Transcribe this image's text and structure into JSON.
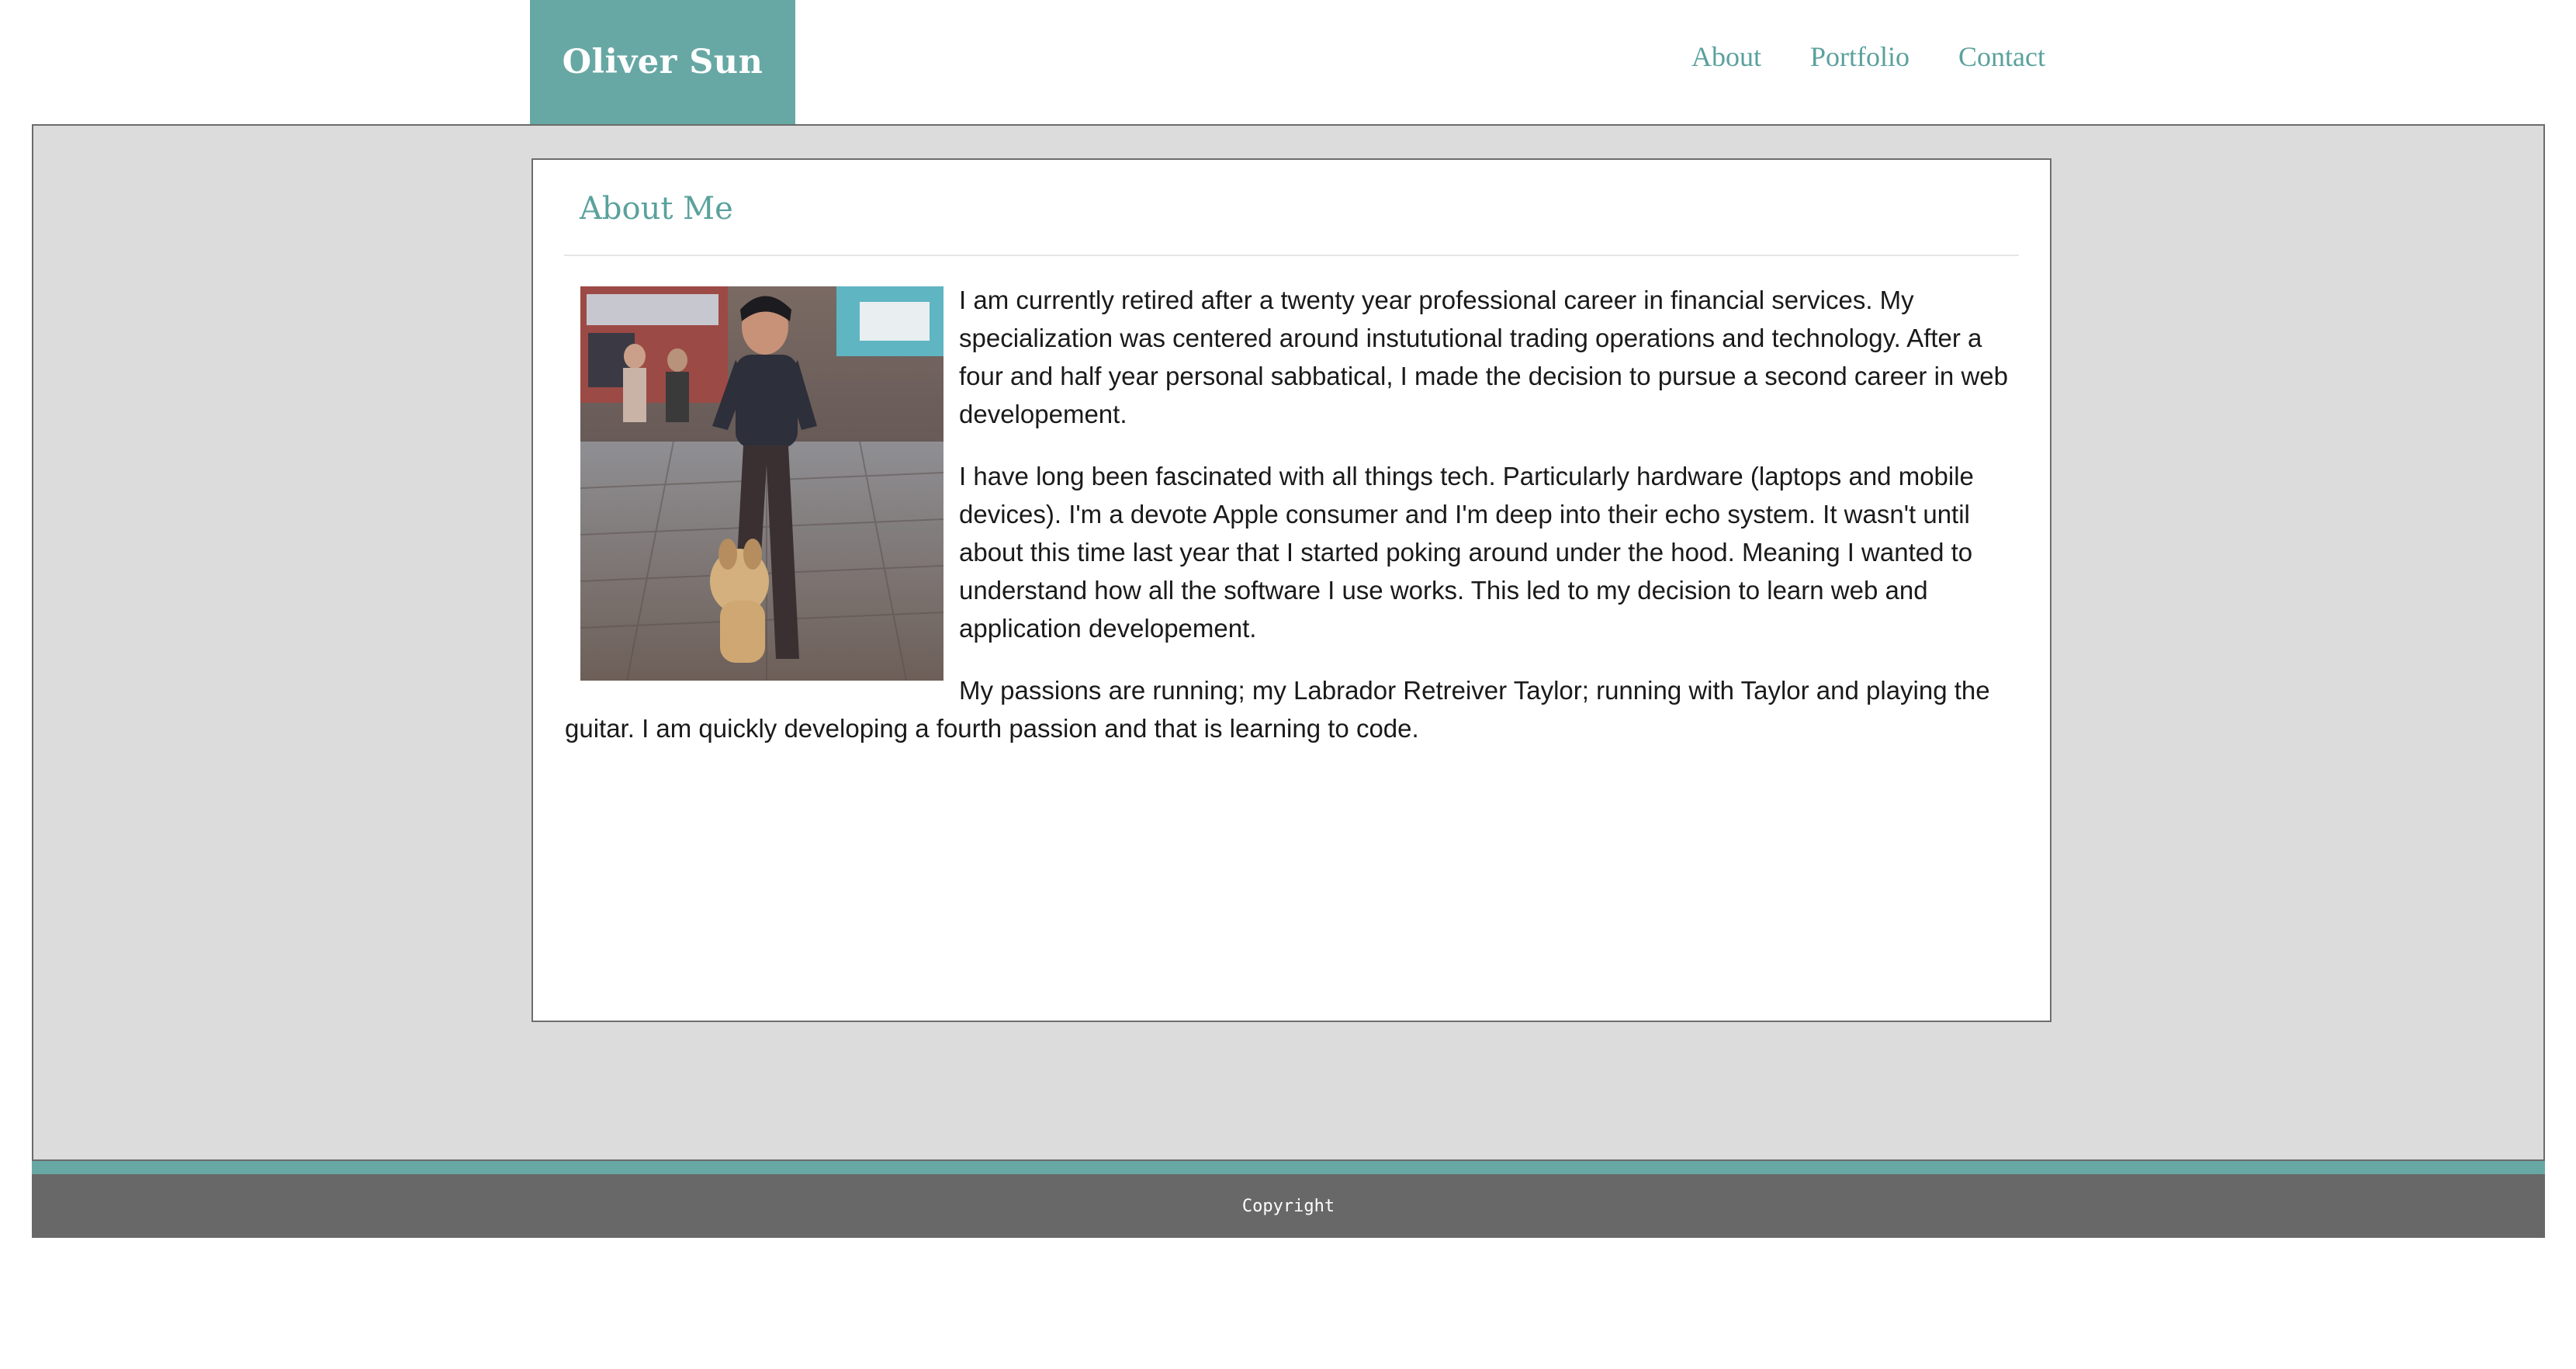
{
  "header": {
    "brand": "Oliver Sun",
    "nav": [
      {
        "label": "About"
      },
      {
        "label": "Portfolio"
      },
      {
        "label": "Contact"
      }
    ]
  },
  "about": {
    "title": "About Me",
    "paragraphs": [
      "I am currently retired after a twenty year professional career in financial services. My specialization was centered around instututional trading operations and technology. After a four and half year personal sabbatical, I made the decision to pursue a second career in web developement.",
      "I have long been fascinated with all things tech. Particularly hardware (laptops and mobile devices). I'm a devote Apple consumer and I'm deep into their echo system. It wasn't until about this time last year that I started poking around under the hood. Meaning I wanted to understand how all the software I use works. This led to my decision to learn web and application developement.",
      "My passions are running; my Labrador Retreiver Taylor; running with Taylor and playing the guitar. I am quickly developing a fourth passion and that is learning to code."
    ]
  },
  "footer": {
    "text": "Copyright"
  },
  "colors": {
    "accent": "#67a8a4",
    "nav_link": "#5aa19d",
    "band_bg": "#dcdcdc",
    "footer_bg": "#686868"
  }
}
